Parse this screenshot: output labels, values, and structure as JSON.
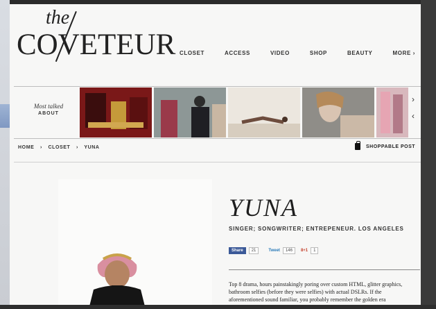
{
  "logo": {
    "the": "the",
    "word": "COVETEUR"
  },
  "nav": [
    "CLOSET",
    "ACCESS",
    "VIDEO",
    "SHOP",
    "BEAUTY",
    "MORE ›"
  ],
  "strip": {
    "line1": "Most talked",
    "line2": "ABOUT",
    "next": "›",
    "prev": "‹"
  },
  "breadcrumb": [
    "HOME",
    "›",
    "CLOSET",
    "›",
    "YUNA"
  ],
  "shoppable": "SHOPPABLE POST",
  "article": {
    "title": "YUNA",
    "subtitle": "SINGER; SONGWRITER; ENTREPENEUR. LOS ANGELES",
    "share": {
      "fb_label": "Share",
      "fb_count": "21",
      "tw_label": "Tweet",
      "tw_count": "146",
      "gp_label": "8+1",
      "gp_count": "1"
    },
    "body": "Top 8 drama, hours painstakingly poring over custom HTML, glitter graphics, bathroom selfies (before they were selfies) with actual DSLRs. If the aforementioned sound familiar, you probably remember the golden era"
  }
}
